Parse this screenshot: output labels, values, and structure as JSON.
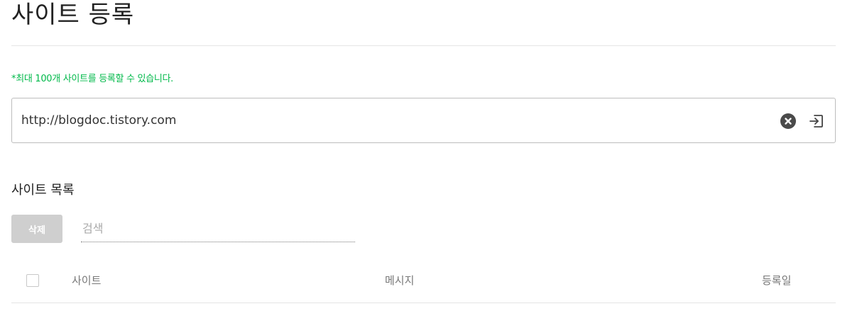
{
  "header": {
    "title": "사이트 등록"
  },
  "notice": "*최대 100개 사이트를 등록할 수 있습니다.",
  "url_field": {
    "value": "http://blogdoc.tistory.com"
  },
  "icons": {
    "clear": "clear-circle-x-icon",
    "submit": "enter-arrow-icon"
  },
  "colors": {
    "notice": "#00b94a",
    "delete_button_disabled": "#cfcfcf"
  },
  "site_list": {
    "title": "사이트 목록",
    "delete_label": "삭제",
    "search_placeholder": "검색",
    "columns": [
      "사이트",
      "메시지",
      "등록일"
    ]
  }
}
